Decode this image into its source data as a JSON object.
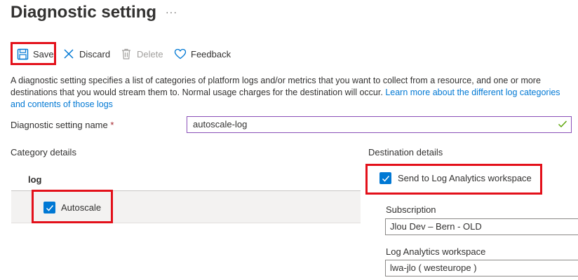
{
  "page": {
    "title": "Diagnostic setting",
    "more": "···"
  },
  "toolbar": {
    "save": "Save",
    "discard": "Discard",
    "delete": "Delete",
    "feedback": "Feedback"
  },
  "description": {
    "text": "A diagnostic setting specifies a list of categories of platform logs and/or metrics that you want to collect from a resource, and one or more destinations that you would stream them to. Normal usage charges for the destination will occur. ",
    "link": "Learn more about the different log categories and contents of those logs"
  },
  "name_field": {
    "label": "Diagnostic setting name",
    "required_mark": "*",
    "value": "autoscale-log"
  },
  "category": {
    "heading": "Category details",
    "log_header": "log",
    "items": [
      {
        "label": "Autoscale",
        "checked": true
      }
    ]
  },
  "destination": {
    "heading": "Destination details",
    "log_analytics": {
      "label": "Send to Log Analytics workspace",
      "checked": true
    },
    "subscription": {
      "label": "Subscription",
      "value": "Jlou Dev – Bern - OLD"
    },
    "workspace": {
      "label": "Log Analytics workspace",
      "value": "lwa-jlo ( westeurope )"
    }
  },
  "colors": {
    "accent": "#0078d4",
    "highlight": "#e3101a",
    "valid": "#57a300"
  }
}
